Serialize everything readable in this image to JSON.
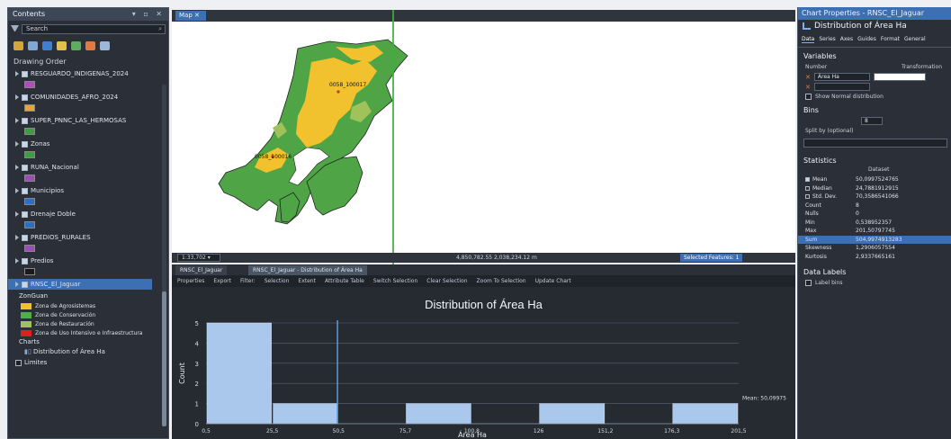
{
  "contents": {
    "title": "Contents",
    "search_placeholder": "Search",
    "drawing_order_label": "Drawing Order",
    "layers": [
      {
        "name": "RESGUARDO_INDIGENAS_2024",
        "swatch": "#b34dbe"
      },
      {
        "name": "COMUNIDADES_AFRO_2024",
        "swatch": "#e3a63a"
      },
      {
        "name": "SUPER_PNNC_LAS_HERMOSAS",
        "swatch": "#3f9e3f"
      },
      {
        "name": "Zonas",
        "swatch": "#3f9e3f"
      },
      {
        "name": "RUNA_Nacional",
        "swatch": "#9a4fb5"
      },
      {
        "name": "Municipios",
        "swatch": "#2b6fc7"
      },
      {
        "name": "Drenaje Doble",
        "swatch": "#2b6fc7"
      },
      {
        "name": "PREDIOS_RURALES",
        "swatch": "#9a4fb5"
      },
      {
        "name": "Predios",
        "swatch": "#1a1a1a"
      }
    ],
    "selected_layer": "RNSC_El_Jaguar",
    "field_name": "ZonGuan",
    "legend": [
      {
        "label": "Zona de Agrosistemas",
        "color": "#f2c12e"
      },
      {
        "label": "Zona de Conservación",
        "color": "#4fb04a"
      },
      {
        "label": "Zona de Restauración",
        "color": "#9fc25a"
      },
      {
        "label": "Zona de Uso Intensivo e Infraestructura",
        "color": "#e02020"
      }
    ],
    "charts_label": "Charts",
    "chart_item": "Distribution of Área Ha",
    "last_layer": "Limites"
  },
  "map": {
    "tab": "Map",
    "labels": [
      "0058_100017",
      "0058_100016"
    ],
    "scale": "1:33,702",
    "coords": "4,850,782.55 2,038,234.12 m",
    "selected_features": "Selected Features: 1"
  },
  "chart_panel": {
    "tabs": [
      "RNSC_El_Jaguar",
      "RNSC_El_Jaguar - Distribution of Área Ha"
    ],
    "toolbar": [
      "Properties",
      "Export",
      "Filter:",
      "Selection",
      "Extent",
      "Attribute Table",
      "Switch Selection",
      "Clear Selection",
      "Zoom To Selection",
      "Update Chart"
    ]
  },
  "chart_data": {
    "type": "bar",
    "title": "Distribution of Área Ha",
    "xlabel": "Área Ha",
    "ylabel": "Count",
    "bin_edges": [
      0.5,
      25.5,
      50.5,
      75.7,
      100.8,
      126,
      151.2,
      176.3,
      201.5
    ],
    "tick_labels": [
      "0,5",
      "25,5",
      "50,5",
      "75,7",
      "100,8",
      "126",
      "151,2",
      "176,3",
      "201,5"
    ],
    "values": [
      5,
      1,
      0,
      1,
      0,
      1,
      0,
      1
    ],
    "ylim": [
      0,
      5
    ],
    "y_ticks": [
      "0",
      "1",
      "2",
      "3",
      "4",
      "5"
    ],
    "mean_value": 50.09975,
    "mean_label": "Mean: 50,09975",
    "grid": true
  },
  "properties": {
    "header": "Chart Properties - RNSC_El_Jaguar",
    "chart_name": "Distribution of Área Ha",
    "tabs": [
      "Data",
      "Series",
      "Axes",
      "Guides",
      "Format",
      "General"
    ],
    "variables_label": "Variables",
    "number_label": "Number",
    "transformation_label": "Transformation",
    "number_field": "Área Ha",
    "show_normal": "Show Normal distribution",
    "bins_label": "Bins",
    "bins_value": "8",
    "split_label": "Split by (optional)",
    "statistics_label": "Statistics",
    "dataset_label": "Dataset",
    "stats": [
      {
        "name": "Mean",
        "value": "50,0997524765"
      },
      {
        "name": "Median",
        "value": "24,7881912915"
      },
      {
        "name": "Std. Dev.",
        "value": "70,3586541066"
      },
      {
        "name": "Count",
        "value": "8"
      },
      {
        "name": "Nulls",
        "value": "0"
      },
      {
        "name": "Min",
        "value": "0,538952357"
      },
      {
        "name": "Max",
        "value": "201,50797745"
      },
      {
        "name": "Sum",
        "value": "504,9974913283"
      },
      {
        "name": "Skewness",
        "value": "1,2906057554"
      },
      {
        "name": "Kurtosis",
        "value": "2,9337665161"
      }
    ],
    "data_labels": "Data Labels",
    "label_bins": "Label bins"
  }
}
